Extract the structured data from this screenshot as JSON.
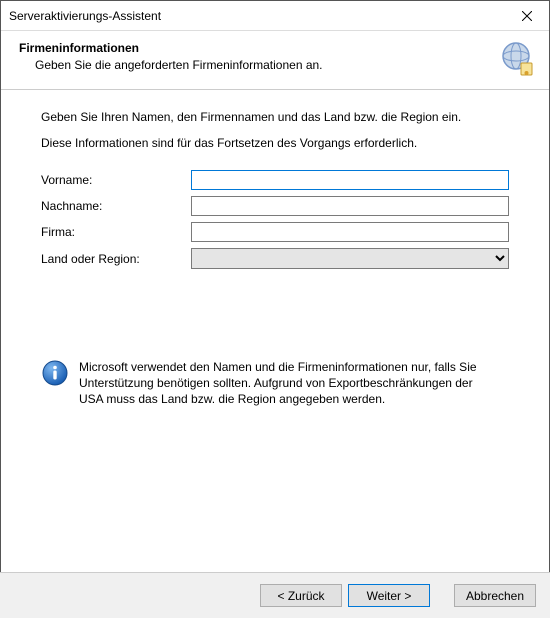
{
  "window": {
    "title": "Serveraktivierungs-Assistent"
  },
  "header": {
    "heading": "Firmeninformationen",
    "sub": "Geben Sie die angeforderten Firmeninformationen an."
  },
  "content": {
    "instr1": "Geben Sie Ihren Namen, den Firmennamen und das Land bzw. die Region ein.",
    "instr2": "Diese Informationen sind für das Fortsetzen des Vorgangs erforderlich.",
    "fields": {
      "firstname_label": "Vorname:",
      "firstname_value": "",
      "lastname_label": "Nachname:",
      "lastname_value": "",
      "company_label": "Firma:",
      "company_value": "",
      "country_label": "Land oder Region:",
      "country_value": ""
    },
    "info": "Microsoft verwendet den Namen und die Firmeninformationen nur, falls Sie Unterstützung benötigen sollten. Aufgrund von Exportbeschränkungen der USA muss das Land bzw. die Region angegeben werden."
  },
  "footer": {
    "back": "< Zurück",
    "next": "Weiter >",
    "cancel": "Abbrechen"
  }
}
